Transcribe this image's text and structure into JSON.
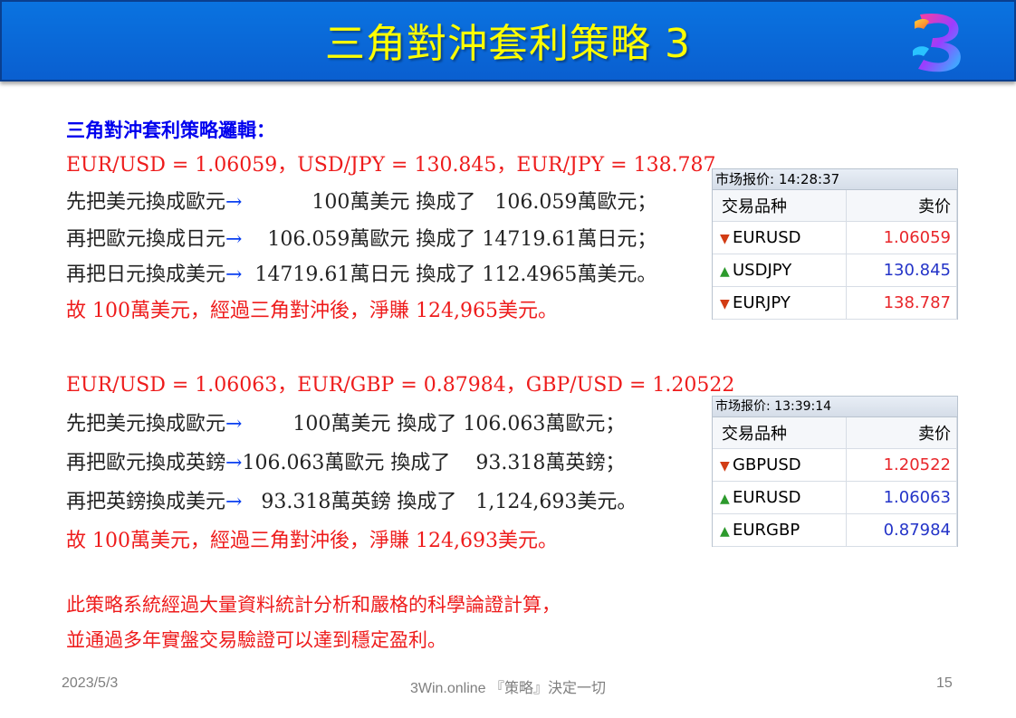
{
  "header": {
    "title": "三角對沖套利策略 3"
  },
  "section1": {
    "heading": "三角對沖套利策略邏輯：",
    "rates": "EUR/USD = 1.06059，USD/JPY = 130.845，EUR/JPY = 138.787",
    "steps": [
      {
        "lead": "先把美元換成歐元",
        "arrow": "→",
        "body": "           100萬美元 換成了   106.059萬歐元；"
      },
      {
        "lead": "再把歐元換成日元",
        "arrow": "→",
        "body": "    106.059萬歐元 換成了 14719.61萬日元；"
      },
      {
        "lead": "再把日元換成美元",
        "arrow": "→",
        "body": "  14719.61萬日元 換成了 112.4965萬美元。"
      }
    ],
    "conclusion": "故 100萬美元，經過三角對沖後，淨賺 124,965美元。"
  },
  "section2": {
    "rates": "EUR/USD = 1.06063，EUR/GBP = 0.87984，GBP/USD = 1.20522",
    "steps": [
      {
        "lead": "先把美元換成歐元",
        "arrow": "→",
        "body": "        100萬美元 換成了 106.063萬歐元；"
      },
      {
        "lead": "再把歐元換成英鎊",
        "arrow": "→",
        "body": "106.063萬歐元 換成了    93.318萬英鎊；"
      },
      {
        "lead": "再把英鎊換成美元",
        "arrow": "→",
        "body": "   93.318萬英鎊 換成了   1,124,693美元。"
      }
    ],
    "conclusion": "故 100萬美元，經過三角對沖後，淨賺 124,693美元。"
  },
  "closing": {
    "line1": "此策略系統經過大量資料統計分析和嚴格的科學論證計算，",
    "line2": "並通過多年實盤交易驗證可以達到穩定盈利。"
  },
  "quote_panel_1": {
    "header": "市场报价: 14:28:37",
    "col_symbol": "交易品种",
    "col_bid": "卖价",
    "rows": [
      {
        "arrow": "down",
        "symbol": "EURUSD",
        "price": "1.06059",
        "price_color": "red"
      },
      {
        "arrow": "up",
        "symbol": "USDJPY",
        "price": "130.845",
        "price_color": "blue"
      },
      {
        "arrow": "down",
        "symbol": "EURJPY",
        "price": "138.787",
        "price_color": "red"
      }
    ]
  },
  "quote_panel_2": {
    "header": "市场报价: 13:39:14",
    "col_symbol": "交易品种",
    "col_bid": "卖价",
    "rows": [
      {
        "arrow": "down",
        "symbol": "GBPUSD",
        "price": "1.20522",
        "price_color": "red"
      },
      {
        "arrow": "up",
        "symbol": "EURUSD",
        "price": "1.06063",
        "price_color": "blue"
      },
      {
        "arrow": "up",
        "symbol": "EURGBP",
        "price": "0.87984",
        "price_color": "blue"
      }
    ]
  },
  "footer": {
    "date": "2023/5/3",
    "center": "3Win.online 『策略』決定一切",
    "page": "15"
  },
  "colors": {
    "title_bar": "#0a66d8",
    "title_text": "#ffff00",
    "heading": "#0000ee",
    "red_text": "#ee1c1c",
    "arrow": "#0a3ff0"
  }
}
